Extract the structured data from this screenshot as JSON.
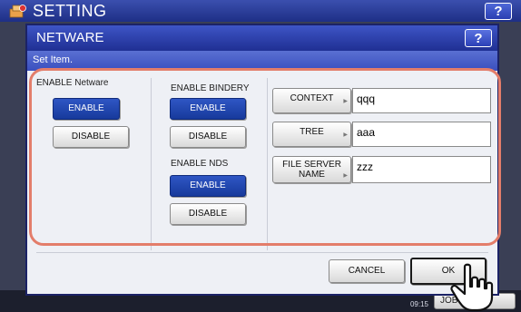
{
  "background": {
    "title": "SETTING",
    "help_label": "?",
    "datetime_time": "09:15",
    "job_status_label": "JOB S"
  },
  "dialog": {
    "title": "NETWARE",
    "help_label": "?",
    "subtitle": "Set Item."
  },
  "netware": {
    "label": "ENABLE Netware",
    "enable_label": "ENABLE",
    "disable_label": "DISABLE"
  },
  "bindery": {
    "label": "ENABLE BINDERY",
    "enable_label": "ENABLE",
    "disable_label": "DISABLE"
  },
  "nds": {
    "label": "ENABLE NDS",
    "enable_label": "ENABLE",
    "disable_label": "DISABLE"
  },
  "fields": {
    "context": {
      "label": "CONTEXT",
      "value": "qqq"
    },
    "tree": {
      "label": "TREE",
      "value": "aaa"
    },
    "file_server": {
      "label_line1": "FILE SERVER",
      "label_line2": "NAME",
      "value": "zzz"
    }
  },
  "footer": {
    "cancel_label": "CANCEL",
    "ok_label": "OK"
  },
  "colors": {
    "titlebar": "#2a3da8",
    "selected_button": "#1f45b0",
    "highlight_outline": "#e37d6a"
  },
  "icons": [
    "settings-logo-icon",
    "pointing-hand-icon",
    "arrow-indicator-icon"
  ]
}
